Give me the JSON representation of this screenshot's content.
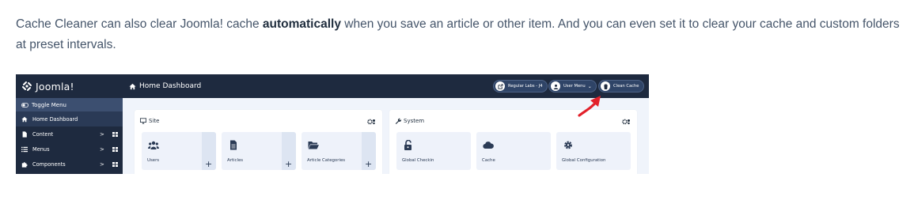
{
  "intro": {
    "part1": "Cache Cleaner can also clear Joomla! cache ",
    "bold": "automatically",
    "part2": " when you save an article or other item. And you can even set it to clear your cache and custom folders at preset intervals."
  },
  "screenshot": {
    "logo_text": "Joomla!",
    "page_title": "Home Dashboard",
    "topbar_buttons": [
      {
        "label": "Regular Labs - J4",
        "icon": "external-link-icon"
      },
      {
        "label": "User Menu",
        "icon": "user-icon"
      },
      {
        "label": "Clean Cache",
        "icon": "trash-icon"
      }
    ],
    "sidebar": {
      "toggle_label": "Toggle Menu",
      "items": [
        {
          "label": "Home Dashboard",
          "icon": "home-icon"
        },
        {
          "label": "Content",
          "icon": "file-icon"
        },
        {
          "label": "Menus",
          "icon": "list-icon"
        },
        {
          "label": "Components",
          "icon": "puzzle-icon"
        }
      ]
    },
    "panels": {
      "site": {
        "title": "Site",
        "tiles": [
          {
            "label": "Users",
            "icon": "users-icon"
          },
          {
            "label": "Articles",
            "icon": "file-text-icon"
          },
          {
            "label": "Article Categories",
            "icon": "folder-open-icon"
          }
        ]
      },
      "system": {
        "title": "System",
        "tiles": [
          {
            "label": "Global Checkin",
            "icon": "unlock-icon"
          },
          {
            "label": "Cache",
            "icon": "cloud-icon"
          },
          {
            "label": "Global Configuration",
            "icon": "cog-icon"
          }
        ]
      }
    },
    "colors": {
      "header_bg": "#1e2a3f",
      "sidebar_bg": "#1e2a3f",
      "toggle_bg": "#3c4f70",
      "content_bg": "#f0f4fb",
      "annotation_arrow": "#e2202a"
    }
  }
}
